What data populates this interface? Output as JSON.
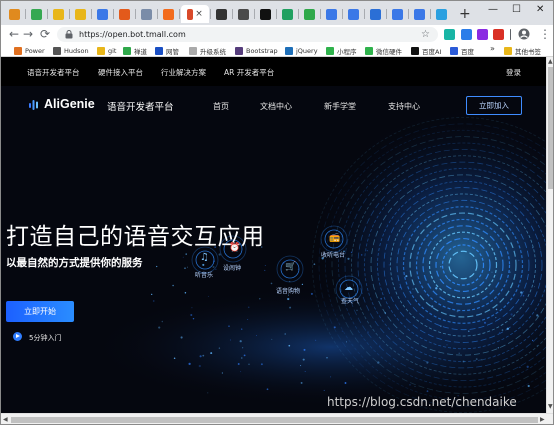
{
  "browser": {
    "tabs": [
      {
        "name": "tab-1",
        "color": "#e08a1e"
      },
      {
        "name": "tab-2",
        "color": "#36a852"
      },
      {
        "name": "tab-3",
        "color": "#e8b61a"
      },
      {
        "name": "tab-4",
        "color": "#e8b61a"
      },
      {
        "name": "tab-5",
        "color": "#3b78e7"
      },
      {
        "name": "tab-6",
        "color": "#e35a1b"
      },
      {
        "name": "tab-7",
        "color": "#7a8ca8"
      },
      {
        "name": "tab-8",
        "color": "#f26b1d"
      },
      {
        "name": "tab-active",
        "color": "#d94a2a"
      },
      {
        "name": "tab-10",
        "color": "#333333"
      },
      {
        "name": "tab-11",
        "color": "#4a4a4a"
      },
      {
        "name": "tab-12",
        "color": "#111111"
      },
      {
        "name": "tab-13",
        "color": "#20a060"
      },
      {
        "name": "tab-14",
        "color": "#2fa84a"
      },
      {
        "name": "tab-15",
        "color": "#3b78e7"
      },
      {
        "name": "tab-16",
        "color": "#3b78e7"
      },
      {
        "name": "tab-17",
        "color": "#2b6fd6"
      },
      {
        "name": "tab-18",
        "color": "#3b78e7"
      },
      {
        "name": "tab-19",
        "color": "#3b78e7"
      },
      {
        "name": "tab-20",
        "color": "#2ba0e0"
      }
    ],
    "tab_close": "×",
    "new_tab": "+",
    "window_controls": {
      "minimize": "—",
      "maximize": "☐",
      "close": "✕"
    },
    "nav": {
      "back": "←",
      "forward": "→",
      "reload": "⟳",
      "home": "⌂"
    },
    "url": "https://open.bot.tmall.com",
    "bookmark_star": "☆",
    "menu_dots": "⋮",
    "extensions": [
      {
        "name": "extension-1",
        "color": "#19b5a5"
      },
      {
        "name": "extension-2",
        "color": "#2b7de9"
      },
      {
        "name": "extension-3",
        "color": "#8a2be2"
      },
      {
        "name": "extension-4",
        "color": "#d93025"
      },
      {
        "name": "extension-5",
        "color": "#5f6368"
      }
    ],
    "bookmarks": [
      {
        "label": "Power",
        "color": "#e07020"
      },
      {
        "label": "Hudson",
        "color": "#555555"
      },
      {
        "label": "git",
        "color": "#e8b61a"
      },
      {
        "label": "禅道",
        "color": "#2fa84a"
      },
      {
        "label": "网管",
        "color": "#1a4fc4"
      },
      {
        "label": "升级系统",
        "color": "#aaaaaa"
      },
      {
        "label": "Bootstrap",
        "color": "#563d7c"
      },
      {
        "label": "jQuery",
        "color": "#1e6fb8"
      },
      {
        "label": "小程序",
        "color": "#2fb24c"
      },
      {
        "label": "微信硬件",
        "color": "#2fb24c"
      },
      {
        "label": "百度AI",
        "color": "#111111"
      },
      {
        "label": "百度",
        "color": "#2b5bd8"
      }
    ],
    "bookmarks_more": "»",
    "bookmarks_other": "其他书签"
  },
  "page": {
    "top_nav": [
      "语音开发者平台",
      "硬件接入平台",
      "行业解决方案",
      "AR 开发者平台"
    ],
    "login": "登录",
    "logo_text": "AliGenie",
    "logo_subtitle": "语音开发者平台",
    "main_nav": [
      "首页",
      "文档中心",
      "新手学堂",
      "支持中心"
    ],
    "join_button": "立即加入",
    "hero_title": "打造自己的语音交互应用",
    "hero_subtitle": "以最自然的方式提供你的服务",
    "start_button": "立即开始",
    "intro_link": "5分钟入门",
    "nodes": [
      {
        "label": "听音乐",
        "icon": "♫"
      },
      {
        "label": "设闹钟",
        "icon": "⏰"
      },
      {
        "label": "语音购物",
        "icon": "🛒"
      },
      {
        "label": "收听电台",
        "icon": "📻"
      },
      {
        "label": "查天气",
        "icon": "☁"
      }
    ]
  },
  "watermark": "https://blog.csdn.net/chendaike",
  "scroll": {
    "up": "▲",
    "down": "▼",
    "left": "◀",
    "right": "▶"
  }
}
